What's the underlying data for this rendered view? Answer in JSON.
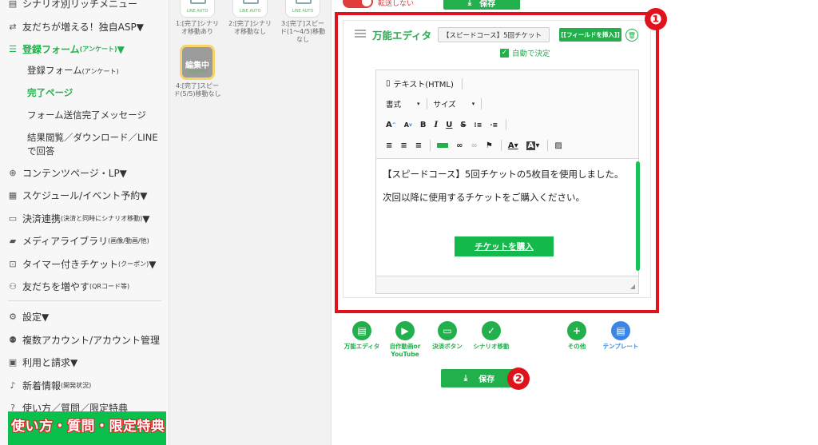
{
  "sidebar": {
    "items": [
      {
        "label": "シナリオ別リッチメニュー",
        "icon": "rich-menu-icon"
      },
      {
        "label": "友だちが増える！独自ASP▼",
        "icon": "handshake-icon"
      },
      {
        "label": "登録フォーム",
        "small": "(アンケート)",
        "suffix": "▼",
        "icon": "list-icon"
      },
      {
        "label": "コンテンツページ・LP▼",
        "icon": "globe-icon"
      },
      {
        "label": "スケジュール/イベント予約▼",
        "icon": "calendar-icon"
      },
      {
        "label": "決済連携",
        "small": "(決済と同時にシナリオ移動)",
        "suffix": "▼",
        "icon": "card-icon"
      },
      {
        "label": "メディアライブラリ",
        "small": "(画像/動画/他)",
        "icon": "folder-icon"
      },
      {
        "label": "タイマー付きチケット",
        "small": "(クーポン)",
        "suffix": "▼",
        "icon": "ticket-icon"
      },
      {
        "label": "友だちを増やす",
        "small": "(QRコード等)",
        "icon": "add-user-icon"
      },
      {
        "label": "設定▼",
        "icon": "gear-icon"
      },
      {
        "label": "複数アカウント/アカウント管理",
        "icon": "account-icon"
      },
      {
        "label": "利用と請求▼",
        "icon": "bill-icon"
      },
      {
        "label": "新着情報",
        "small": "(開発状況)",
        "icon": "bell-icon"
      },
      {
        "label": "使い方／質問／限定特典",
        "icon": "help-icon"
      }
    ],
    "sub_items": [
      {
        "label": "登録フォーム",
        "small": "(アンケート)"
      },
      {
        "label": "完了ページ"
      },
      {
        "label": "フォーム送信完了メッセージ"
      },
      {
        "label": "結果閲覧／ダウンロード／LINEで回答"
      }
    ],
    "banner_text": "使い方・質問・限定特典"
  },
  "scenarios": [
    {
      "caption": "1:[完了]シナリオ移動あり",
      "thumb": "LINE AUTO"
    },
    {
      "caption": "2:[完了]シナリオ移動なし",
      "thumb": "LINE AUTO"
    },
    {
      "caption": "3:[完了]スピード(1〜4/5)移動なし",
      "thumb": "LINE AUTO"
    },
    {
      "caption": "4:[完了]スピード(5/5)移動なし",
      "thumb": "LINE AUTO",
      "badge": "編集中"
    }
  ],
  "main": {
    "toggle_label": "転送しない",
    "top_save_label": "保存",
    "editor": {
      "title": "万能エディタ",
      "title_input_value": "【スピードコース】5回チケット",
      "insert_field_label": "[[フィールドを挿入]]",
      "auto_decide_label": "自動で決定",
      "mode_label": "テキスト(HTML)",
      "format_label": "書式",
      "size_label": "サイズ",
      "content_p1": "【スピードコース】5回チケットの5枚目を使用しました。",
      "content_p2": "次回以降に使用するチケットをご購入ください。",
      "ticket_button_label": "チケットを購入"
    },
    "add_buttons": [
      {
        "label": "万能エディタ",
        "icon": "editor-icon"
      },
      {
        "label": "自作動画or YouTube",
        "icon": "youtube-icon"
      },
      {
        "label": "決済ボタン",
        "icon": "payment-icon"
      },
      {
        "label": "シナリオ移動",
        "icon": "check-icon"
      },
      {
        "label": "その他",
        "icon": "plus-icon"
      },
      {
        "label": "テンプレート",
        "icon": "template-icon"
      }
    ],
    "save_label": "保存",
    "annotations": [
      "❶",
      "❷"
    ]
  },
  "colors": {
    "accent": "#21b04b",
    "highlight": "#e0121b",
    "blue": "#3a86e6"
  }
}
